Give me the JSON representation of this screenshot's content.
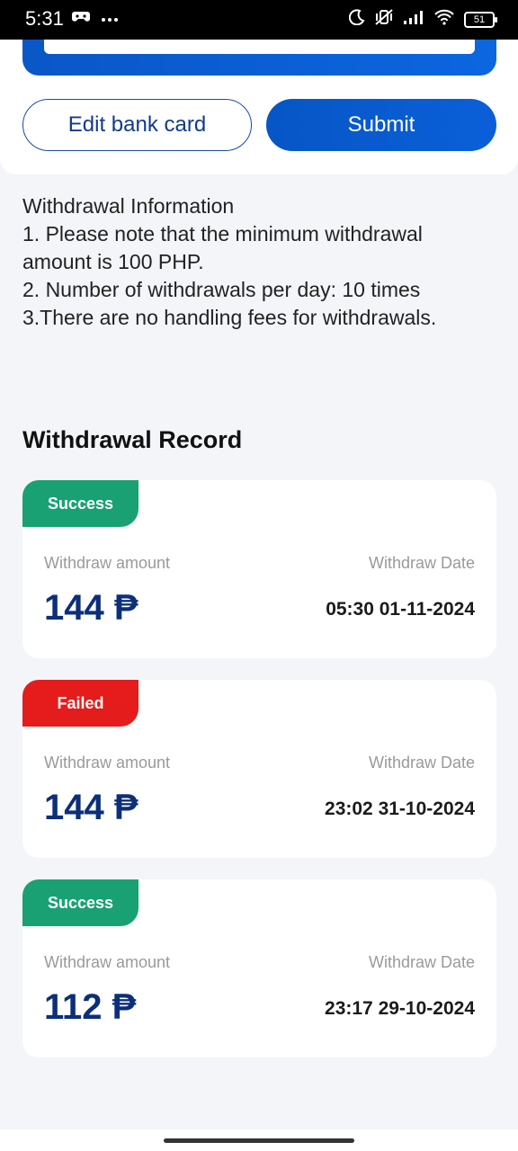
{
  "status_bar": {
    "time": "5:31",
    "battery": "51"
  },
  "actions": {
    "edit_label": "Edit bank card",
    "submit_label": "Submit"
  },
  "info": {
    "title": "Withdrawal Information",
    "lines": [
      "1. Please note that the minimum withdrawal amount is 100 PHP.",
      "2. Number of withdrawals per day: 10 times",
      "3.There are no handling fees for withdrawals."
    ]
  },
  "record_section_title": "Withdrawal Record",
  "records": [
    {
      "status": "Success",
      "status_color": "#19a173",
      "amount_label": "Withdraw amount",
      "date_label": "Withdraw Date",
      "amount": "144 ₱",
      "date": "05:30 01-11-2024"
    },
    {
      "status": "Failed",
      "status_color": "#e41c1c",
      "amount_label": "Withdraw amount",
      "date_label": "Withdraw Date",
      "amount": "144 ₱",
      "date": "23:02 31-10-2024"
    },
    {
      "status": "Success",
      "status_color": "#19a173",
      "amount_label": "Withdraw amount",
      "date_label": "Withdraw Date",
      "amount": "112 ₱",
      "date": "23:17 29-10-2024"
    }
  ]
}
